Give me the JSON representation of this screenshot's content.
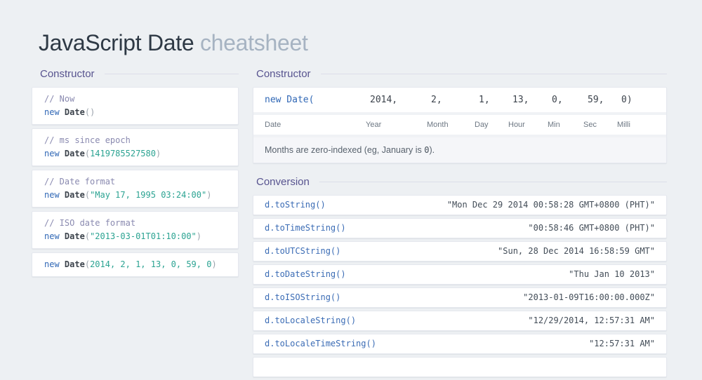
{
  "title": {
    "primary": "JavaScript Date",
    "secondary": "cheatsheet"
  },
  "colors": {
    "page_background": "#edf0f3",
    "heading_purple": "#57538f",
    "comment_purple": "#8a8ab0",
    "keyword_blue": "#3168b6",
    "literal_teal": "#2ba392",
    "code_dark": "#3c434c",
    "title_dark": "#2e3945",
    "title_light": "#a6b3c2"
  },
  "left_panel": {
    "heading": "Constructor",
    "blocks": [
      {
        "comment": "// Now",
        "keyword": "new",
        "fn": "Date",
        "open": "(",
        "arg": "",
        "close": ")"
      },
      {
        "comment": "// ms since epoch",
        "keyword": "new",
        "fn": "Date",
        "open": "(",
        "arg": "1419785527580",
        "close": ")"
      },
      {
        "comment": "// Date format",
        "keyword": "new",
        "fn": "Date",
        "open": "(",
        "arg": "\"May 17, 1995 03:24:00\"",
        "close": ")"
      },
      {
        "comment": "// ISO date format",
        "keyword": "new",
        "fn": "Date",
        "open": "(",
        "arg": "\"2013-03-01T01:10:00\"",
        "close": ")"
      },
      {
        "comment": "",
        "keyword": "new",
        "fn": "Date",
        "open": "(",
        "arg": "2014, 2, 1, 13, 0, 59, 0",
        "close": ")"
      }
    ]
  },
  "constructor_panel": {
    "heading": "Constructor",
    "signature": "new Date(",
    "values": [
      "2014,",
      "2,",
      "1,",
      "13,",
      "0,",
      "59,",
      "0)"
    ],
    "labels": [
      "Date",
      "Year",
      "Month",
      "Day",
      "Hour",
      "Min",
      "Sec",
      "Milli"
    ],
    "note_prefix": "Months are zero-indexed (eg, January is ",
    "note_code": "0",
    "note_suffix": ")."
  },
  "conversion_panel": {
    "heading": "Conversion",
    "rows": [
      {
        "method": "d.toString()",
        "result": "\"Mon Dec 29 2014 00:58:28 GMT+0800 (PHT)\""
      },
      {
        "method": "d.toTimeString()",
        "result": "\"00:58:46 GMT+0800 (PHT)\""
      },
      {
        "method": "d.toUTCString()",
        "result": "\"Sun, 28 Dec 2014 16:58:59 GMT\""
      },
      {
        "method": "d.toDateString()",
        "result": "\"Thu Jan 10 2013\""
      },
      {
        "method": "d.toISOString()",
        "result": "\"2013-01-09T16:00:00.000Z\""
      },
      {
        "method": "d.toLocaleString()",
        "result": "\"12/29/2014, 12:57:31 AM\""
      },
      {
        "method": "d.toLocaleTimeString()",
        "result": "\"12:57:31 AM\""
      }
    ]
  }
}
